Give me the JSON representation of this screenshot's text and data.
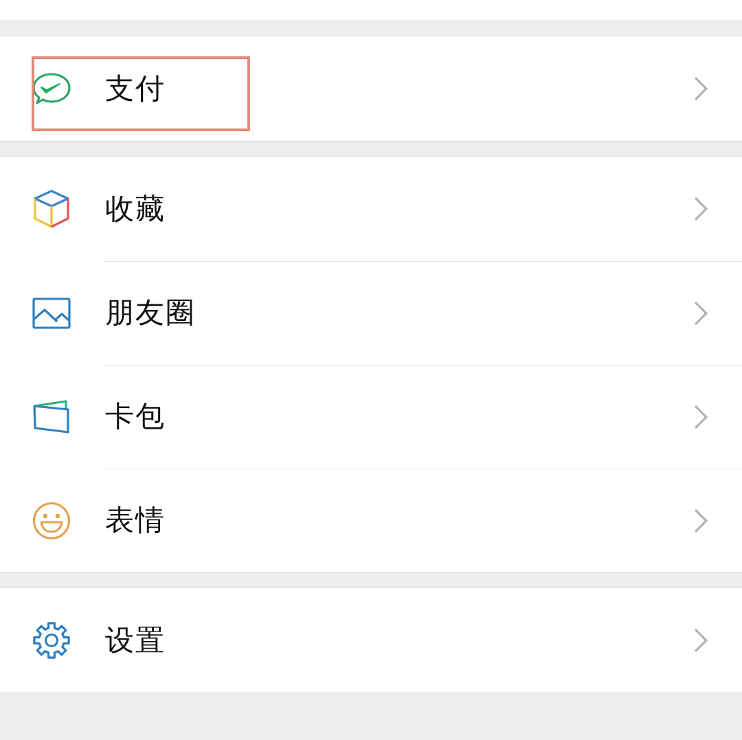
{
  "sections": [
    {
      "items": [
        {
          "kind": "pay",
          "label": "支付",
          "highlighted": true
        }
      ]
    },
    {
      "items": [
        {
          "kind": "favorites",
          "label": "收藏",
          "highlighted": false
        },
        {
          "kind": "moments",
          "label": "朋友圈",
          "highlighted": false
        },
        {
          "kind": "cards",
          "label": "卡包",
          "highlighted": false
        },
        {
          "kind": "stickers",
          "label": "表情",
          "highlighted": false
        }
      ]
    },
    {
      "items": [
        {
          "kind": "settings",
          "label": "设置",
          "highlighted": false
        }
      ]
    }
  ]
}
